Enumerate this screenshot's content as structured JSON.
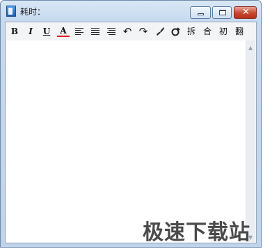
{
  "window": {
    "title": "耗时：",
    "controls": {
      "minimize": "–",
      "maximize": "□",
      "close": "✕"
    }
  },
  "toolbar": {
    "bold": "B",
    "italic": "I",
    "underline": "U",
    "font_color": "A",
    "align_left_icon": "align-left-icon",
    "align_center_icon": "align-center-icon",
    "align_right_icon": "align-right-icon",
    "undo": "↶",
    "redo": "↷",
    "format_brush": "🖌",
    "clear_format": "✎",
    "split": "拆",
    "merge": "合",
    "initial": "初",
    "translate": "翻"
  },
  "editor": {
    "value": ""
  },
  "scrollbar": {
    "up": "▲",
    "down": "▼"
  },
  "watermark": "极速下载站",
  "colors": {
    "font_color_underline": "#e02020",
    "close_button": "#c7472f"
  }
}
